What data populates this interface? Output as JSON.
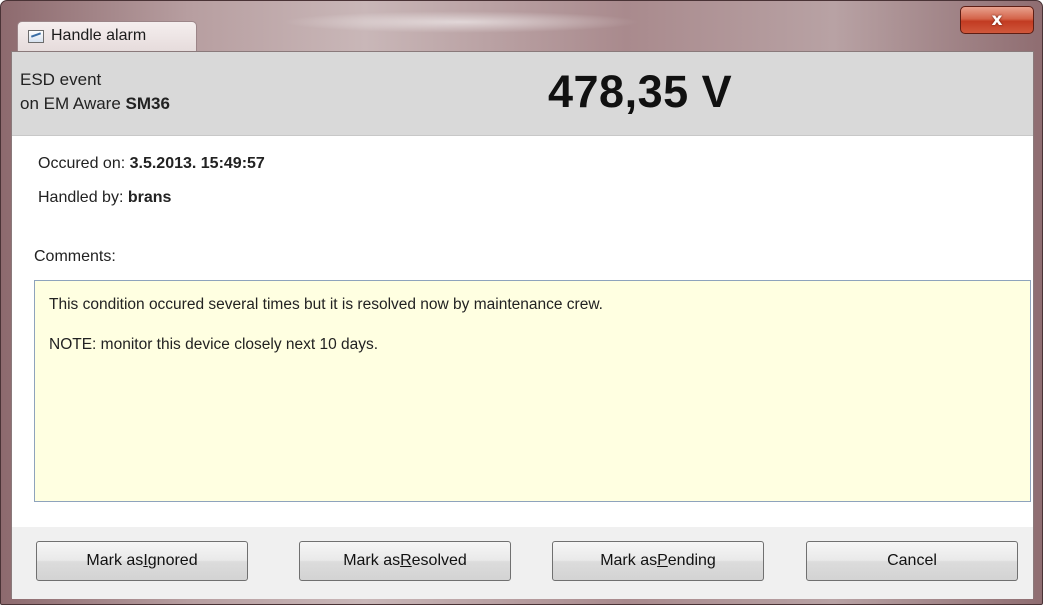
{
  "window": {
    "title": "Handle alarm",
    "close_label": "x"
  },
  "header": {
    "event_type": "ESD event",
    "device_prefix": "on EM Aware ",
    "device_name": "SM36",
    "reading": "478,35 V"
  },
  "details": {
    "occurred_label": "Occured on: ",
    "occurred_value": "3.5.2013. 15:49:57",
    "handled_label": "Handled by: ",
    "handled_value": "brans"
  },
  "comments": {
    "label": "Comments:",
    "line1": "This condition occured several times but it is resolved now by maintenance crew.",
    "line2": "NOTE: monitor this device closely next 10 days."
  },
  "buttons": {
    "ignored_prefix": "Mark as ",
    "ignored_mnemonic": "I",
    "ignored_rest": "gnored",
    "resolved_prefix": "Mark as ",
    "resolved_mnemonic": "R",
    "resolved_rest": "esolved",
    "pending_prefix": "Mark as ",
    "pending_mnemonic": "P",
    "pending_rest": "ending",
    "cancel": "Cancel"
  }
}
